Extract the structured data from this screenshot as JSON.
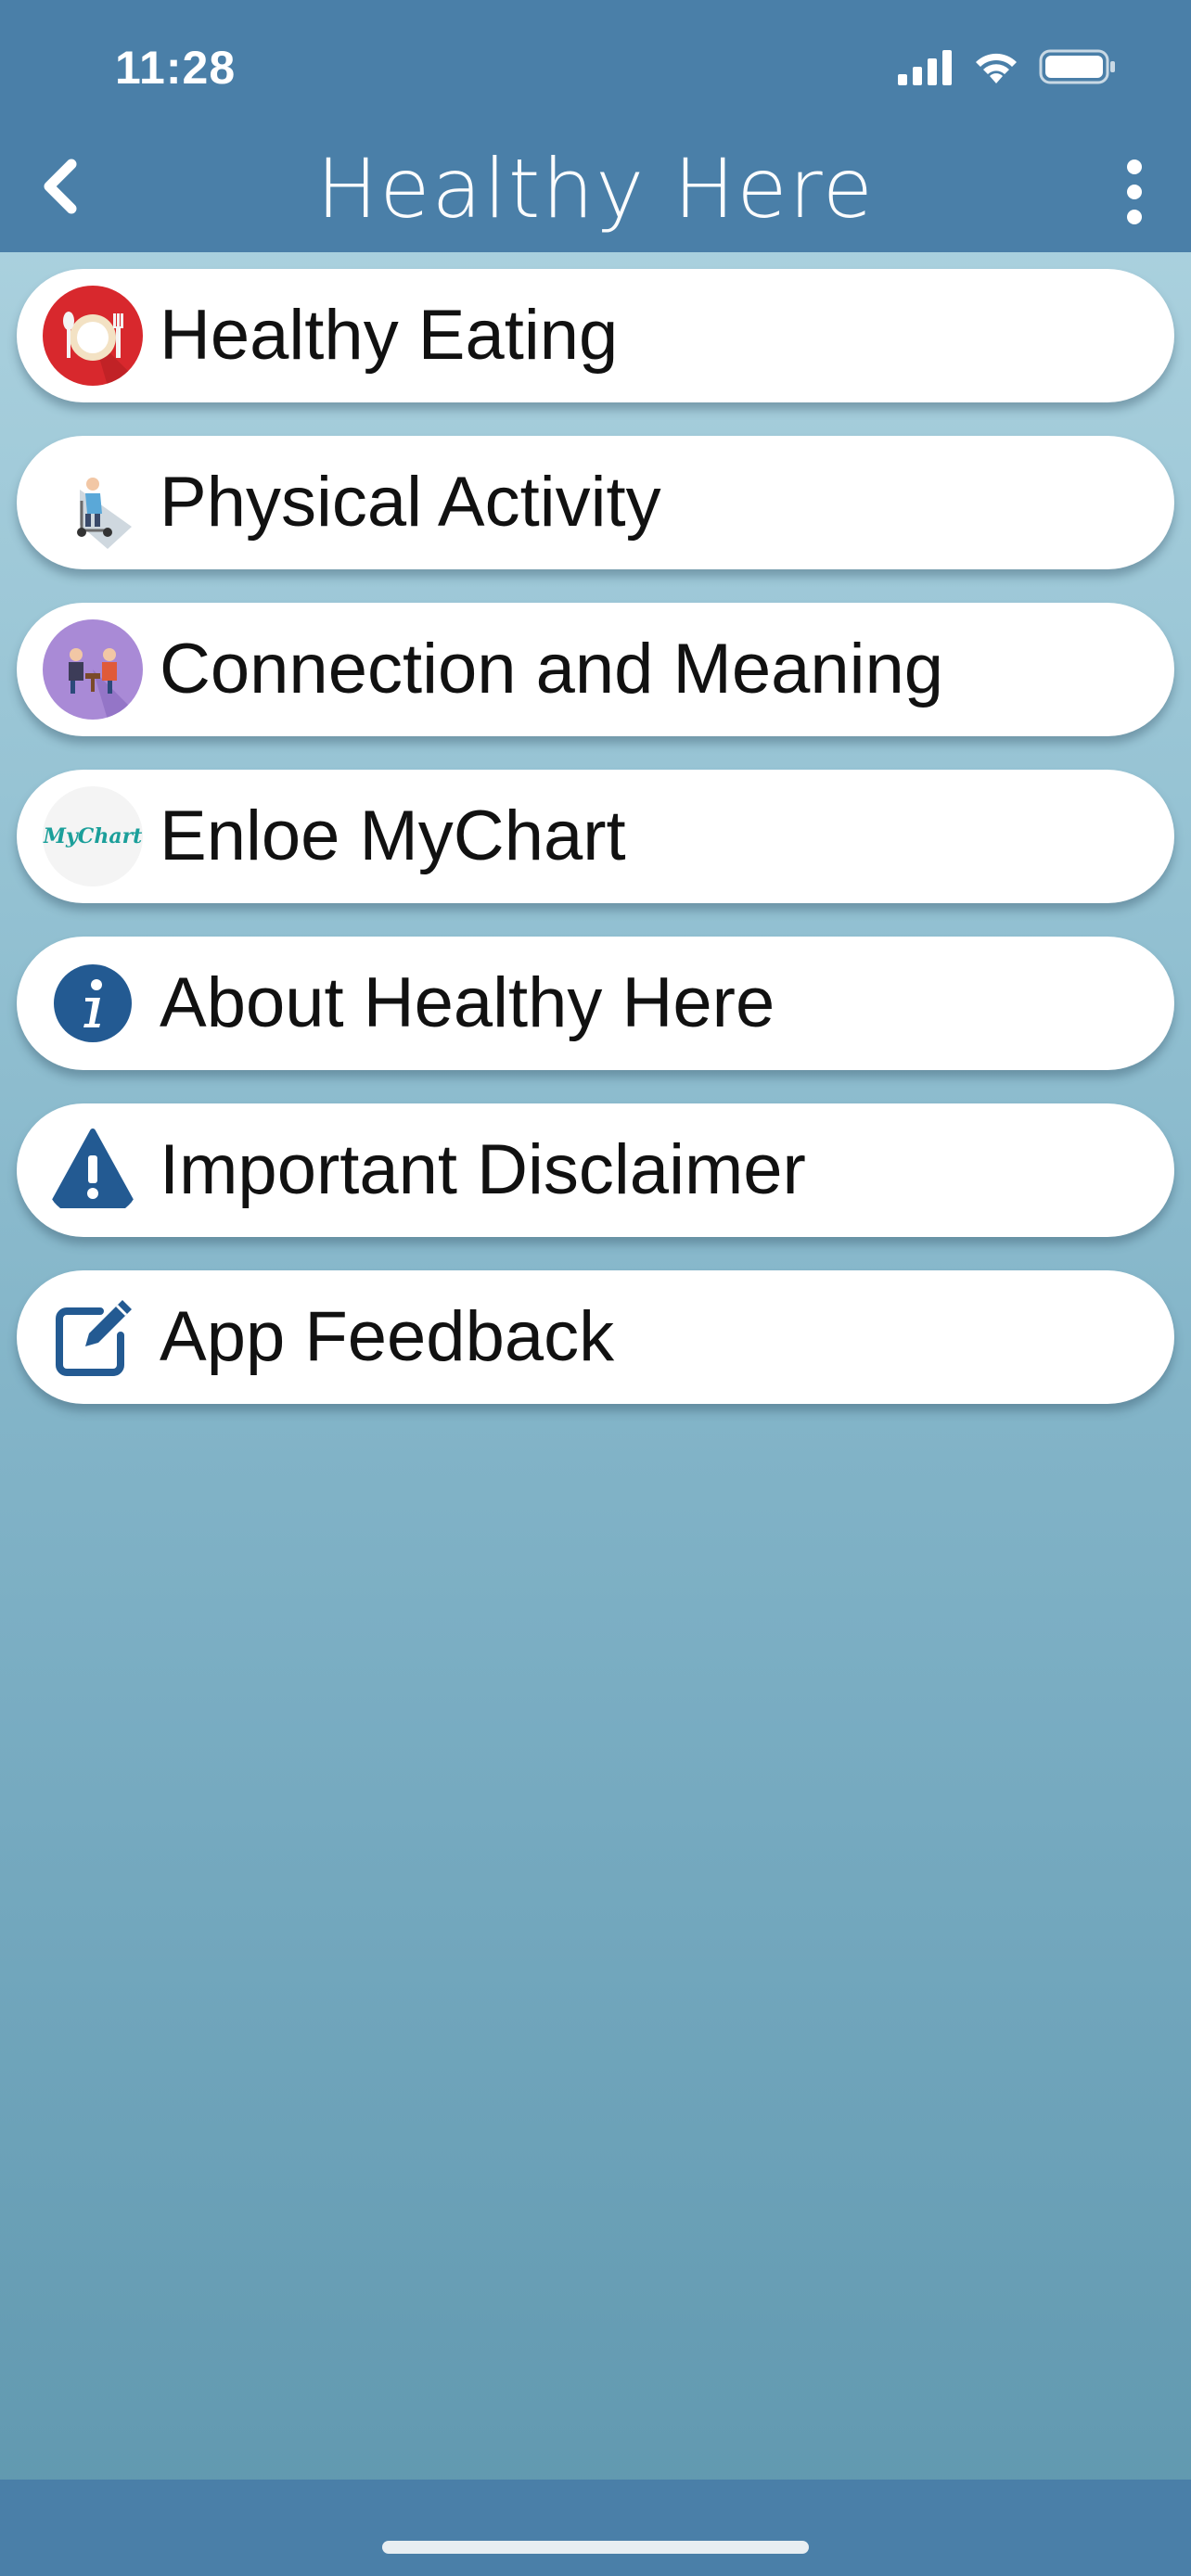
{
  "status_bar": {
    "time": "11:28",
    "icons": [
      "cellular-signal-icon",
      "wifi-icon",
      "battery-icon"
    ]
  },
  "header": {
    "title": "Healthy Here",
    "back_icon": "chevron-left-icon",
    "more_icon": "more-vertical-icon",
    "background_color": "#4a7fa8"
  },
  "menu": {
    "items": [
      {
        "label": "Healthy Eating",
        "icon": "plate-utensils-icon",
        "icon_color": "#d8282d"
      },
      {
        "label": "Physical Activity",
        "icon": "scooter-person-icon",
        "icon_color": "#cfd8df"
      },
      {
        "label": "Connection and Meaning",
        "icon": "people-talking-icon",
        "icon_color": "#a98ad6"
      },
      {
        "label": "Enloe MyChart",
        "icon": "mychart-logo-icon",
        "icon_color": "#1b9f9a",
        "logo_text": "MyChart"
      },
      {
        "label": "About Healthy Here",
        "icon": "info-circle-icon",
        "icon_color": "#235a92"
      },
      {
        "label": "Important Disclaimer",
        "icon": "warning-triangle-icon",
        "icon_color": "#235a92"
      },
      {
        "label": "App Feedback",
        "icon": "edit-square-icon",
        "icon_color": "#235a92"
      }
    ]
  }
}
